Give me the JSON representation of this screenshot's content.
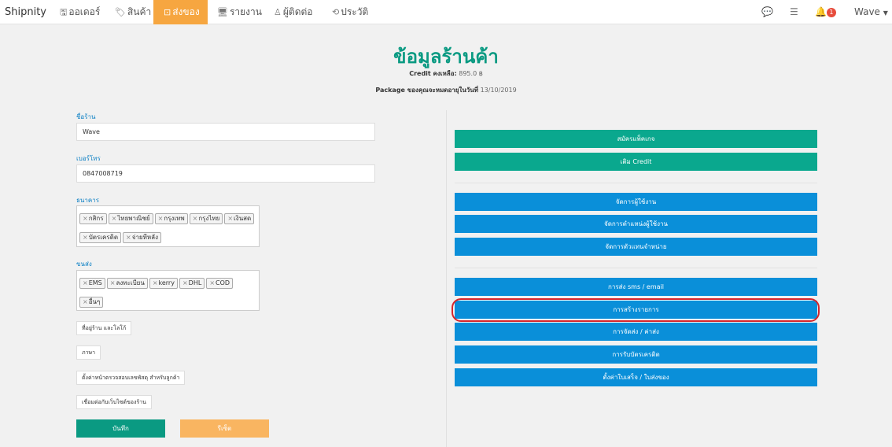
{
  "nav": {
    "brand": "Shipnity",
    "items": [
      {
        "icon": "🖫",
        "label": "ออเดอร์"
      },
      {
        "icon": "🏷",
        "label": "สินค้า"
      },
      {
        "icon": "⊡",
        "label": "ส่งของ"
      },
      {
        "icon": "🖥",
        "label": "รายงาน"
      },
      {
        "icon": "♙",
        "label": "ผู้ติดต่อ"
      },
      {
        "icon": "⟲",
        "label": "ประวัติ"
      }
    ],
    "notif_count": "1",
    "user": "Wave"
  },
  "header": {
    "title": "ข้อมูลร้านค้า",
    "credit_label": "Credit คงเหลือ:",
    "credit_value": "895.0 ฿",
    "package_label": "Package ของคุณจะหมดอายุในวันที่",
    "package_date": "13/10/2019"
  },
  "form": {
    "shop_name_label": "ชื่อร้าน",
    "shop_name_value": "Wave",
    "phone_label": "เบอร์โทร",
    "phone_value": "0847008719",
    "bank_label": "ธนาคาร",
    "bank_tags": [
      "กสิกร",
      "ไทยพาณิชย์",
      "กรุงเทพ",
      "กรุงไทย",
      "เงินสด",
      "บัตรเครดิต",
      "จ่ายทีหลัง"
    ],
    "shipping_label": "ขนส่ง",
    "shipping_tags": [
      "EMS",
      "ลงทะเบียน",
      "kerry",
      "DHL",
      "COD",
      "อื่นๆ"
    ],
    "address_logo_button": "ที่อยู่ร้าน และโลโก้",
    "language_button": "ภาษา",
    "tracking_page_button": "ตั้งค่าหน้าตรวจสอบเลขพัสดุ สำหรับลูกค้า",
    "website_button": "เชื่อมต่อกับเว็บไซต์ของร้าน",
    "save_button": "บันทึก",
    "reset_button": "รีเซ็ต"
  },
  "actions": {
    "package": "สมัครแพ็คเกจ",
    "add_credit": "เติม Credit",
    "users": "จัดการผู้ใช้งาน",
    "positions": "จัดการตำแหน่งผู้ใช้งาน",
    "dealers": "จัดการตัวแทนจำหน่าย",
    "sms_email": "การส่ง sms / email",
    "create_list": "การสร้างรายการ",
    "shipping_fee": "การจัดส่ง / ค่าส่ง",
    "credit_card": "การรับบัตรเครดิต",
    "receipt": "ตั้งค่าใบเสร็จ / ใบส่งของ"
  },
  "colors": {
    "teal": "#0aa88e",
    "blue": "#0a8fd9",
    "orange": "#f6a640",
    "highlight": "#d6262c"
  }
}
